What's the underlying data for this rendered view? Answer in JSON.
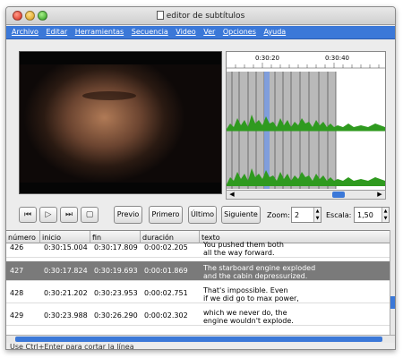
{
  "window": {
    "title": "editor de subtítulos"
  },
  "menu": [
    "Archivo",
    "Editar",
    "Herramientas",
    "Secuencia",
    "Video",
    "Ver",
    "Opciones",
    "Ayuda"
  ],
  "waveform": {
    "time_labels": [
      "0:30:20",
      "0:30:40"
    ]
  },
  "controls": {
    "prev_label": "Previo",
    "first_label": "Primero",
    "last_label": "Último",
    "next_label": "Siguiente",
    "zoom_label": "Zoom:",
    "zoom_value": "2",
    "scale_label": "Escala:",
    "scale_value": "1,50"
  },
  "table": {
    "headers": [
      "número",
      "inicio",
      "fin",
      "duración",
      "texto"
    ],
    "rows": [
      {
        "num": "426",
        "start": "0:30:15.004",
        "end": "0:30:17.809",
        "dur": "0:00:02.205",
        "text1": "You pushed them both",
        "text2": "all the way forward."
      },
      {
        "num": "427",
        "start": "0:30:17.824",
        "end": "0:30:19.693",
        "dur": "0:00:01.869",
        "text1": "The starboard engine exploded",
        "text2": "and the cabin depressurized."
      },
      {
        "num": "428",
        "start": "0:30:21.202",
        "end": "0:30:23.953",
        "dur": "0:00:02.751",
        "text1": "That's impossible. Even",
        "text2": "if we did go to max power,"
      },
      {
        "num": "429",
        "start": "0:30:23.988",
        "end": "0:30:26.290",
        "dur": "0:00:02.302",
        "text1": "which we never do, the",
        "text2": "engine wouldn't explode."
      }
    ],
    "selected_row": 1
  },
  "status": "Use Ctrl+Enter para cortar la línea",
  "colors": {
    "accent": "#3b78d8",
    "selection": "#7a7a7a",
    "wave": "#2f9a1f"
  }
}
